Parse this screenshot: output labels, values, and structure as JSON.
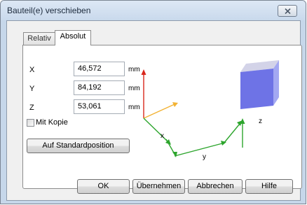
{
  "window": {
    "title": "Bauteil(e) verschieben"
  },
  "tabs": [
    {
      "label": "Relativ",
      "active": false
    },
    {
      "label": "Absolut",
      "active": true
    }
  ],
  "fields": [
    {
      "axis": "X",
      "value": "46,572",
      "unit": "mm"
    },
    {
      "axis": "Y",
      "value": "84,192",
      "unit": "mm"
    },
    {
      "axis": "Z",
      "value": "53,061",
      "unit": "mm"
    }
  ],
  "checkbox": {
    "label": "Mit Kopie",
    "checked": false
  },
  "buttons": {
    "standard_position": "Auf Standardposition",
    "ok": "OK",
    "apply": "Übernehmen",
    "cancel": "Abbrechen",
    "help": "Hilfe"
  },
  "diagram": {
    "labels": {
      "x": "x",
      "y": "y",
      "z": "z"
    },
    "colors": {
      "axis_up": "#d9261c",
      "axis_diag": "#f2b233",
      "axis_green": "#2da52d",
      "cube_front": "#6e73e6",
      "cube_top": "#d3d3e8",
      "cube_side": "#a3a8f2"
    }
  }
}
